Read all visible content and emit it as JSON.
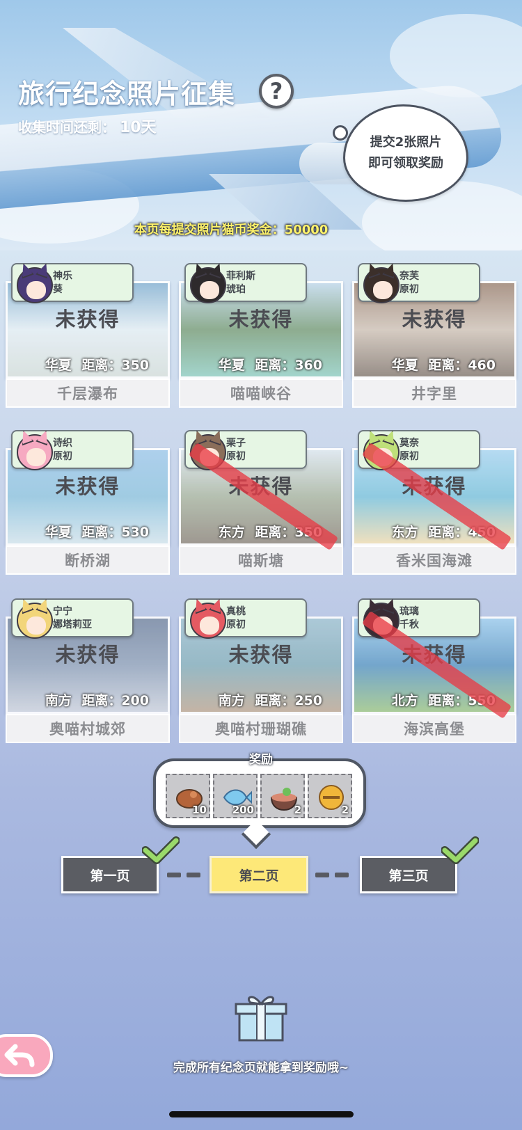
{
  "header": {
    "title": "旅行纪念照片征集",
    "help_icon": "?",
    "countdown_label": "收集时间还剩：",
    "countdown_value": "10天"
  },
  "bubble": {
    "line1": "提交2张照片",
    "line2": "即可领取奖励"
  },
  "bonus_text": "本页每提交照片猫币奖金：50000",
  "cards": [
    {
      "name": "千层瀑布",
      "status": "未获得",
      "region": "华夏",
      "distance": "距离：350",
      "char1": "神乐",
      "char2": "葵",
      "photo": [
        "#6fa3c9",
        "#e0ecf2",
        "#cfd9d4"
      ],
      "avatar": "#4a3b78",
      "crossed": false
    },
    {
      "name": "喵喵峡谷",
      "status": "未获得",
      "region": "华夏",
      "distance": "距离：360",
      "char1": "菲利斯",
      "char2": "琥珀",
      "photo": [
        "#b7d3e7",
        "#5f8a5e",
        "#7ec6b6"
      ],
      "avatar": "#2e2a2c",
      "crossed": false
    },
    {
      "name": "井字里",
      "status": "未获得",
      "region": "华夏",
      "distance": "距离：460",
      "char1": "奈芙",
      "char2": "原初",
      "photo": [
        "#8a6a55",
        "#c9b8a8",
        "#6e5e52"
      ],
      "avatar": "#3b2f2a",
      "crossed": false
    },
    {
      "name": "断桥湖",
      "status": "未获得",
      "region": "华夏",
      "distance": "距离：530",
      "char1": "诗织",
      "char2": "原初",
      "photo": [
        "#8fc0e6",
        "#7bbad9",
        "#cfe3ea"
      ],
      "avatar": "#f6a9c1",
      "crossed": false
    },
    {
      "name": "喵斯塘",
      "status": "未获得",
      "region": "东方",
      "distance": "距离：350",
      "char1": "栗子",
      "char2": "原初",
      "photo": [
        "#d9e4ec",
        "#9aa88e",
        "#7a6f60"
      ],
      "avatar": "#8a6e5a",
      "crossed": true
    },
    {
      "name": "香米国海滩",
      "status": "未获得",
      "region": "东方",
      "distance": "距离：450",
      "char1": "莫奈",
      "char2": "原初",
      "photo": [
        "#9bd0ef",
        "#63b9d6",
        "#f1d9a3"
      ],
      "avatar": "#bfe07a",
      "crossed": true
    },
    {
      "name": "奥喵村城郊",
      "status": "未获得",
      "region": "南方",
      "distance": "距离：200",
      "char1": "宁宁",
      "char2": "娜塔莉亚",
      "photo": [
        "#5b6f8e",
        "#7f93ae",
        "#c7cdd8"
      ],
      "avatar": "#f2d57a",
      "crossed": false
    },
    {
      "name": "奥喵村珊瑚礁",
      "status": "未获得",
      "region": "南方",
      "distance": "距离：250",
      "char1": "真桃",
      "char2": "原初",
      "photo": [
        "#8fb7c9",
        "#6fa0ae",
        "#b59a7f"
      ],
      "avatar": "#e45a62",
      "crossed": false
    },
    {
      "name": "海滨高堡",
      "status": "未获得",
      "region": "北方",
      "distance": "距离：550",
      "char1": "琉璃",
      "char2": "千秋",
      "photo": [
        "#8cc4ea",
        "#3c84b8",
        "#8fbe6e"
      ],
      "avatar": "#3a2c34",
      "crossed": true
    }
  ],
  "rewards": {
    "label": "奖励",
    "items": [
      {
        "icon": "fried-fish-icon",
        "count": "10",
        "color": "#b4643a"
      },
      {
        "icon": "blue-fish-icon",
        "count": "200",
        "color": "#7fc9ee"
      },
      {
        "icon": "ramen-bowl-icon",
        "count": "2",
        "color": "#d98a72"
      },
      {
        "icon": "golden-bell-icon",
        "count": "2",
        "color": "#f0b63a"
      }
    ]
  },
  "pages": [
    {
      "label": "第一页",
      "done": true
    },
    {
      "label": "第二页",
      "done": false,
      "active": true
    },
    {
      "label": "第三页",
      "done": true
    }
  ],
  "footer": {
    "text": "完成所有纪念页就能拿到奖励哦~"
  },
  "colors": {
    "check": "#9ad96a",
    "slash": "#e83c46",
    "active_page": "#fde878"
  }
}
